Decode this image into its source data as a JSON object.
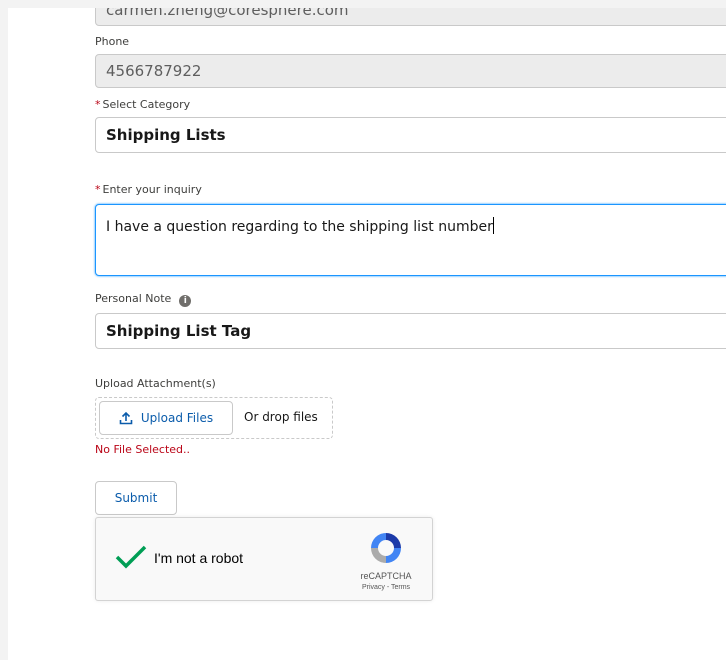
{
  "email": {
    "value": "carmen.zheng@coresphere.com"
  },
  "phone": {
    "label": "Phone",
    "value": "4566787922"
  },
  "category": {
    "required": "*",
    "label": "Select Category",
    "value": "Shipping Lists"
  },
  "inquiry": {
    "required": "*",
    "label": "Enter your inquiry",
    "value": "I have a question regarding to the shipping list number"
  },
  "personal_note": {
    "label": "Personal Note",
    "info_icon": "info-icon",
    "value": "Shipping List Tag"
  },
  "upload": {
    "label": "Upload Attachment(s)",
    "button_label": "Upload Files",
    "button_icon": "upload-icon",
    "drop_text": "Or drop files",
    "status": "No File Selected.."
  },
  "submit": {
    "label": "Submit"
  },
  "captcha": {
    "label": "I'm not a robot",
    "checked": true,
    "brand": "reCAPTCHA",
    "links": "Privacy - Terms"
  },
  "colors": {
    "required": "#ba0517",
    "link": "#0b5cab",
    "focus": "#1b96ff",
    "check": "#009e55"
  }
}
